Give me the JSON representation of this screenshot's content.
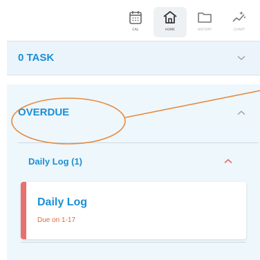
{
  "nav": {
    "items": [
      {
        "label": "CAL",
        "icon": "calendar-icon"
      },
      {
        "label": "HOME",
        "icon": "home-icon"
      },
      {
        "label": "HISTORY",
        "icon": "folder-icon"
      },
      {
        "label": "CHART",
        "icon": "chart-sparkle-icon"
      }
    ],
    "active": "HOME"
  },
  "task_section": {
    "title": "0 TASK"
  },
  "overdue_section": {
    "title": "OVERDUE",
    "group": {
      "title": "Daily Log (1)",
      "card": {
        "title": "Daily Log",
        "due": "Due on 1-17"
      }
    }
  },
  "colors": {
    "accent": "#1a8fd6",
    "overdue_bar": "#e8706e",
    "due_text": "#e2683a",
    "annotation": "#e8893a",
    "group_chevron": "#e8706e"
  }
}
